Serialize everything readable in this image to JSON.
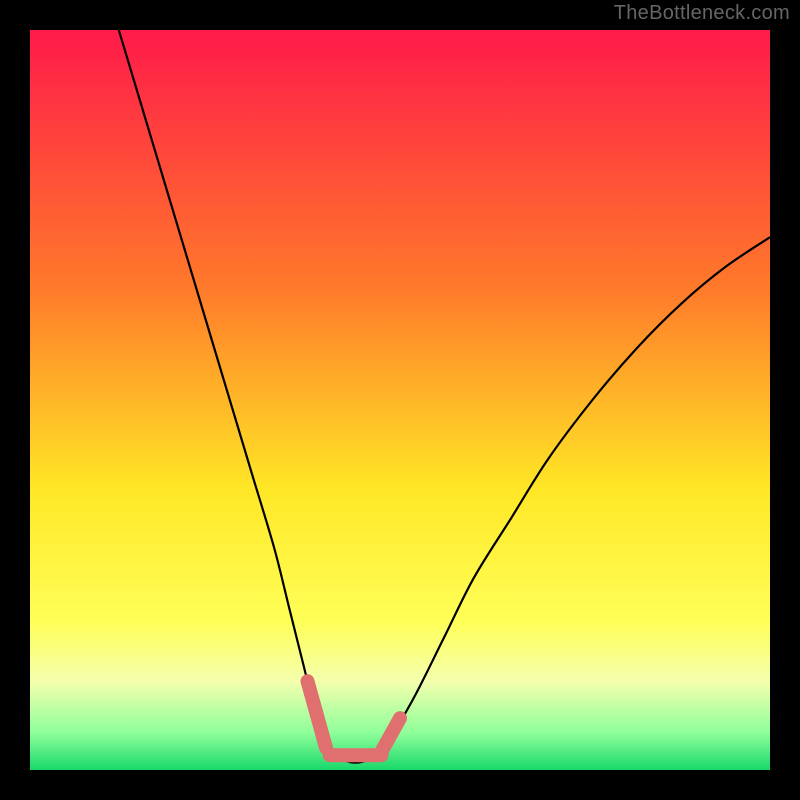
{
  "watermark": "TheBottleneck.com",
  "colors": {
    "frame_bg": "#000000",
    "grad_top": "#ff1a4a",
    "grad_mid1": "#ff6a2f",
    "grad_mid2": "#ffd024",
    "grad_low": "#ffff6a",
    "grad_pale": "#f7ffb0",
    "grad_green": "#1ee87a",
    "curve": "#000000",
    "marker": "#e06f6f"
  },
  "chart_data": {
    "type": "line",
    "title": "",
    "xlabel": "",
    "ylabel": "",
    "xlim": [
      0,
      100
    ],
    "ylim": [
      0,
      100
    ],
    "series": [
      {
        "name": "left_branch",
        "x": [
          12,
          15,
          18,
          21,
          24,
          27,
          30,
          33,
          35,
          37,
          38.5,
          40
        ],
        "y": [
          100,
          90,
          80,
          70,
          60,
          50,
          40,
          30,
          22,
          14,
          8,
          3
        ]
      },
      {
        "name": "right_branch",
        "x": [
          48,
          52,
          56,
          60,
          65,
          70,
          76,
          82,
          88,
          94,
          100
        ],
        "y": [
          3,
          10,
          18,
          26,
          34,
          42,
          50,
          57,
          63,
          68,
          72
        ]
      },
      {
        "name": "valley_floor",
        "x": [
          40,
          42,
          44,
          46,
          48
        ],
        "y": [
          3,
          1.5,
          1,
          1.5,
          3
        ]
      }
    ],
    "markers": [
      {
        "name": "marker-left",
        "x1": 37.5,
        "y1": 12,
        "x2": 40,
        "y2": 3
      },
      {
        "name": "marker-floor",
        "x1": 40.5,
        "y1": 2,
        "x2": 47.5,
        "y2": 2
      },
      {
        "name": "marker-right",
        "x1": 47.5,
        "y1": 2.5,
        "x2": 50,
        "y2": 7
      }
    ],
    "gradient_stops": [
      {
        "y_pct": 0,
        "color": "#ff1a4a"
      },
      {
        "y_pct": 35,
        "color": "#ff7a2a"
      },
      {
        "y_pct": 62,
        "color": "#ffe726"
      },
      {
        "y_pct": 80,
        "color": "#ffff58"
      },
      {
        "y_pct": 88,
        "color": "#f4ffad"
      },
      {
        "y_pct": 95,
        "color": "#8eff9a"
      },
      {
        "y_pct": 100,
        "color": "#18d86a"
      }
    ]
  }
}
